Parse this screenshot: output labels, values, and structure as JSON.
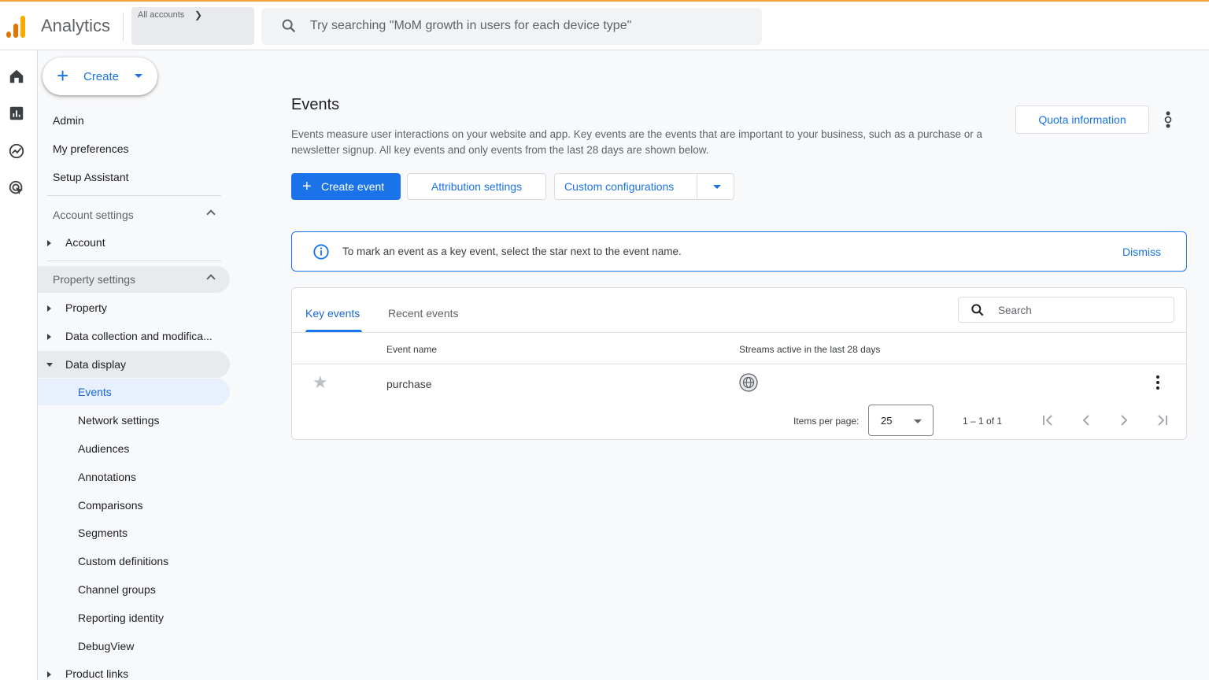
{
  "topbar": {
    "app_name": "Analytics",
    "accounts_label": "All accounts",
    "search_placeholder": "Try searching \"MoM growth in users for each device type\""
  },
  "colors": {
    "accent": "#1a73e8",
    "logo_dark": "#e37400",
    "logo_light": "#f9ab00",
    "topbar_border": "#f4a13a"
  },
  "rail": {
    "icons": [
      "home-icon",
      "reports-icon",
      "explore-icon",
      "advertising-icon"
    ]
  },
  "sidebar": {
    "create_label": "Create",
    "items": {
      "admin": "Admin",
      "my_preferences": "My preferences",
      "setup_assistant": "Setup Assistant",
      "account_settings": "Account settings",
      "account": "Account",
      "property_settings": "Property settings",
      "property": "Property",
      "data_collection": "Data collection and modifica...",
      "data_display": "Data display",
      "events": "Events",
      "network_settings": "Network settings",
      "audiences": "Audiences",
      "annotations": "Annotations",
      "comparisons": "Comparisons",
      "segments": "Segments",
      "custom_definitions": "Custom definitions",
      "channel_groups": "Channel groups",
      "reporting_identity": "Reporting identity",
      "debugview": "DebugView",
      "product_links": "Product links"
    }
  },
  "main": {
    "title": "Events",
    "description": "Events measure user interactions on your website and app. Key events are the events that are important to your business, such as a purchase or a newsletter signup. All key events and only events from the last 28 days are shown below.",
    "quota_button": "Quota information",
    "create_event_button": "Create event",
    "attribution_button": "Attribution settings",
    "custom_config_button": "Custom configurations",
    "banner": {
      "message": "To mark an event as a key event, select the star next to the event name.",
      "dismiss": "Dismiss"
    },
    "tabs": {
      "key_events": "Key events",
      "recent_events": "Recent events"
    },
    "table_search_placeholder": "Search",
    "columns": {
      "event_name": "Event name",
      "streams": "Streams active in the last 28 days"
    },
    "rows": [
      {
        "event_name": "purchase",
        "stream_icon": "web-globe-icon",
        "key_event": false
      }
    ],
    "pagination": {
      "items_per_page_label": "Items per page:",
      "items_per_page_value": "25",
      "range": "1 – 1 of 1"
    }
  }
}
